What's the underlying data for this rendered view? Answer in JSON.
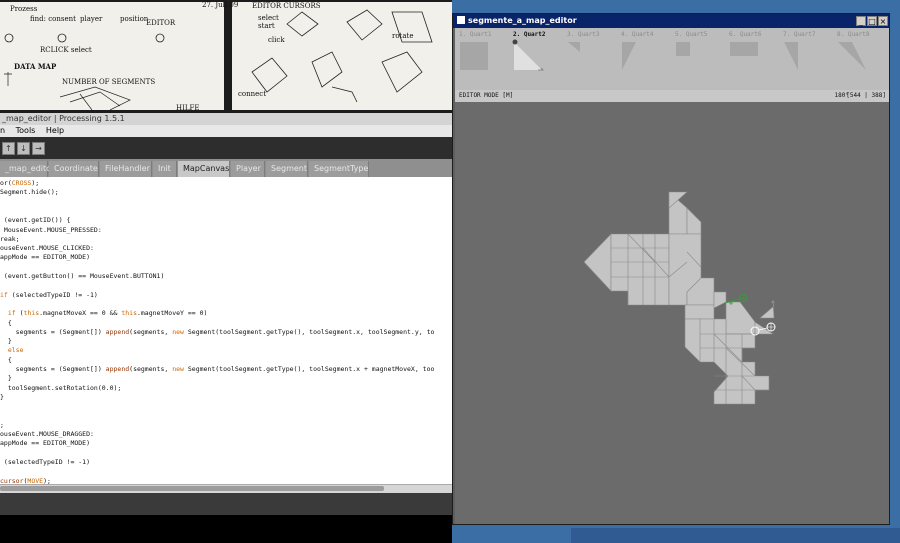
{
  "notebook": {
    "lines_left": [
      "Prozess",
      "find: consent",
      "player",
      "position",
      "EDITOR",
      "RCLICK select",
      "DATA MAP",
      "NUMBER OF SEGMENTS",
      "HILFE"
    ],
    "lines_right": [
      "EDITOR CURSORS",
      "select",
      "start",
      "click",
      "rotate",
      "connect"
    ],
    "date": "27. Juli 09"
  },
  "ide": {
    "title": "_map_editor | Processing 1.5.1",
    "menu": [
      "n",
      "Tools",
      "Help"
    ],
    "tabs": [
      "_map_editor",
      "Coordinate",
      "FileHandler",
      "Init",
      "MapCanvas",
      "Player",
      "Segment",
      "SegmentType"
    ],
    "active_tab": "MapCanvas",
    "code": [
      "or(CROSS);",
      "Segment.hide();",
      "",
      "",
      " (event.getID()) {",
      " MouseEvent.MOUSE_PRESSED:",
      "reak;",
      "ouseEvent.MOUSE_CLICKED:",
      "appMode == EDITOR_MODE)",
      "",
      " (event.getButton() == MouseEvent.BUTTON1)",
      "",
      "if (selectedTypeID != -1)",
      "",
      "  if (this.magnetMoveX == 0 && this.magnetMoveY == 0)",
      "  {",
      "    segments = (Segment[]) append(segments, new Segment(toolSegment.getType(), toolSegment.x, toolSegment.y, to",
      "  }",
      "  else",
      "  {",
      "    segments = (Segment[]) append(segments, new Segment(toolSegment.getType(), toolSegment.x + magnetMoveX, too",
      "  }",
      "  toolSegment.setRotation(0.0);",
      "}",
      "",
      "",
      ";",
      "ouseEvent.MOUSE_DRAGGED:",
      "appMode == EDITOR_MODE)",
      "",
      " (selectedTypeID != -1)",
      "",
      "cursor(MOVE);"
    ]
  },
  "editor": {
    "title": "segmente_a_map_editor",
    "quarts": [
      "1. Quart1",
      "2. Quart2",
      "3. Quart3",
      "4. Quart4",
      "5. Quart5",
      "6. Quart6",
      "7. Quart7",
      "8. Quart8"
    ],
    "selected_quart": "2. Quart2",
    "mode": "EDITOR MODE [M]",
    "rotation": "180°",
    "coords": "[544 | 388]",
    "colors": {
      "canvas": "#6b6b6b",
      "segment": "#c4c4c4",
      "magnet": "#3a9a3a"
    }
  }
}
